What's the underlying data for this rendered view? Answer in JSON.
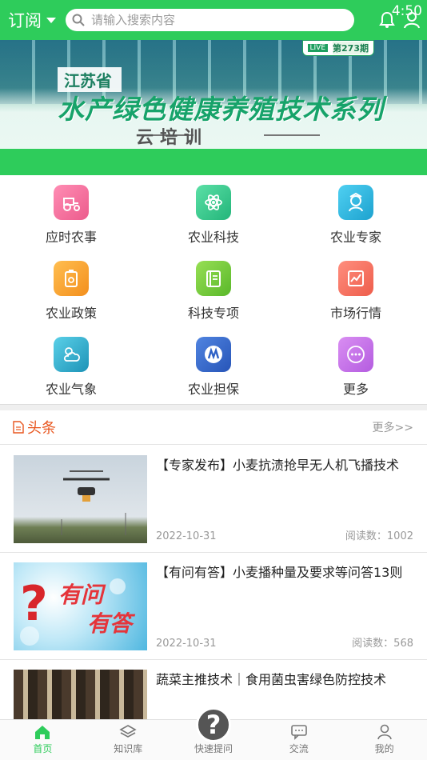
{
  "topbar": {
    "subscribe_label": "订阅",
    "search_placeholder": "请输入搜索内容",
    "time": "4:50"
  },
  "banner": {
    "province": "江苏省",
    "title": "水产绿色健康养殖技术系列",
    "subtitle": "云培训",
    "live": "LIVE",
    "issue": "第273期"
  },
  "grid": [
    {
      "label": "应时农事",
      "icon": "tractor-icon",
      "color": "#f26a9a"
    },
    {
      "label": "农业科技",
      "icon": "atom-icon",
      "color": "#35c98c"
    },
    {
      "label": "农业专家",
      "icon": "expert-icon",
      "color": "#2ab8e0"
    },
    {
      "label": "农业政策",
      "icon": "policy-icon",
      "color": "#f7a02d"
    },
    {
      "label": "科技专项",
      "icon": "book-icon",
      "color": "#6cc93a"
    },
    {
      "label": "市场行情",
      "icon": "chart-icon",
      "color": "#f46a5c"
    },
    {
      "label": "农业气象",
      "icon": "weather-icon",
      "color": "#2aa7c7"
    },
    {
      "label": "农业担保",
      "icon": "guarantee-icon",
      "color": "#3a6fd0"
    },
    {
      "label": "更多",
      "icon": "more-icon",
      "color": "#c86fe6"
    }
  ],
  "headlines": {
    "label": "头条",
    "more": "更多>>"
  },
  "news": [
    {
      "title": "【专家发布】小麦抗渍抢早无人机飞播技术",
      "date": "2022-10-31",
      "reads": "阅读数：1002"
    },
    {
      "title": "【有问有答】小麦播种量及要求等问答13则",
      "date": "2022-10-31",
      "reads": "阅读数：568"
    },
    {
      "title": "蔬菜主推技术｜食用菌虫害绿色防控技术",
      "date": "",
      "reads": ""
    }
  ],
  "nav": [
    {
      "label": "首页",
      "icon": "home-icon"
    },
    {
      "label": "知识库",
      "icon": "layers-icon"
    },
    {
      "label": "快速提问",
      "icon": "question-icon"
    },
    {
      "label": "交流",
      "icon": "chat-icon"
    },
    {
      "label": "我的",
      "icon": "user-icon"
    }
  ],
  "colors": {
    "primary": "#2ecc5b",
    "headline": "#e8561f"
  }
}
